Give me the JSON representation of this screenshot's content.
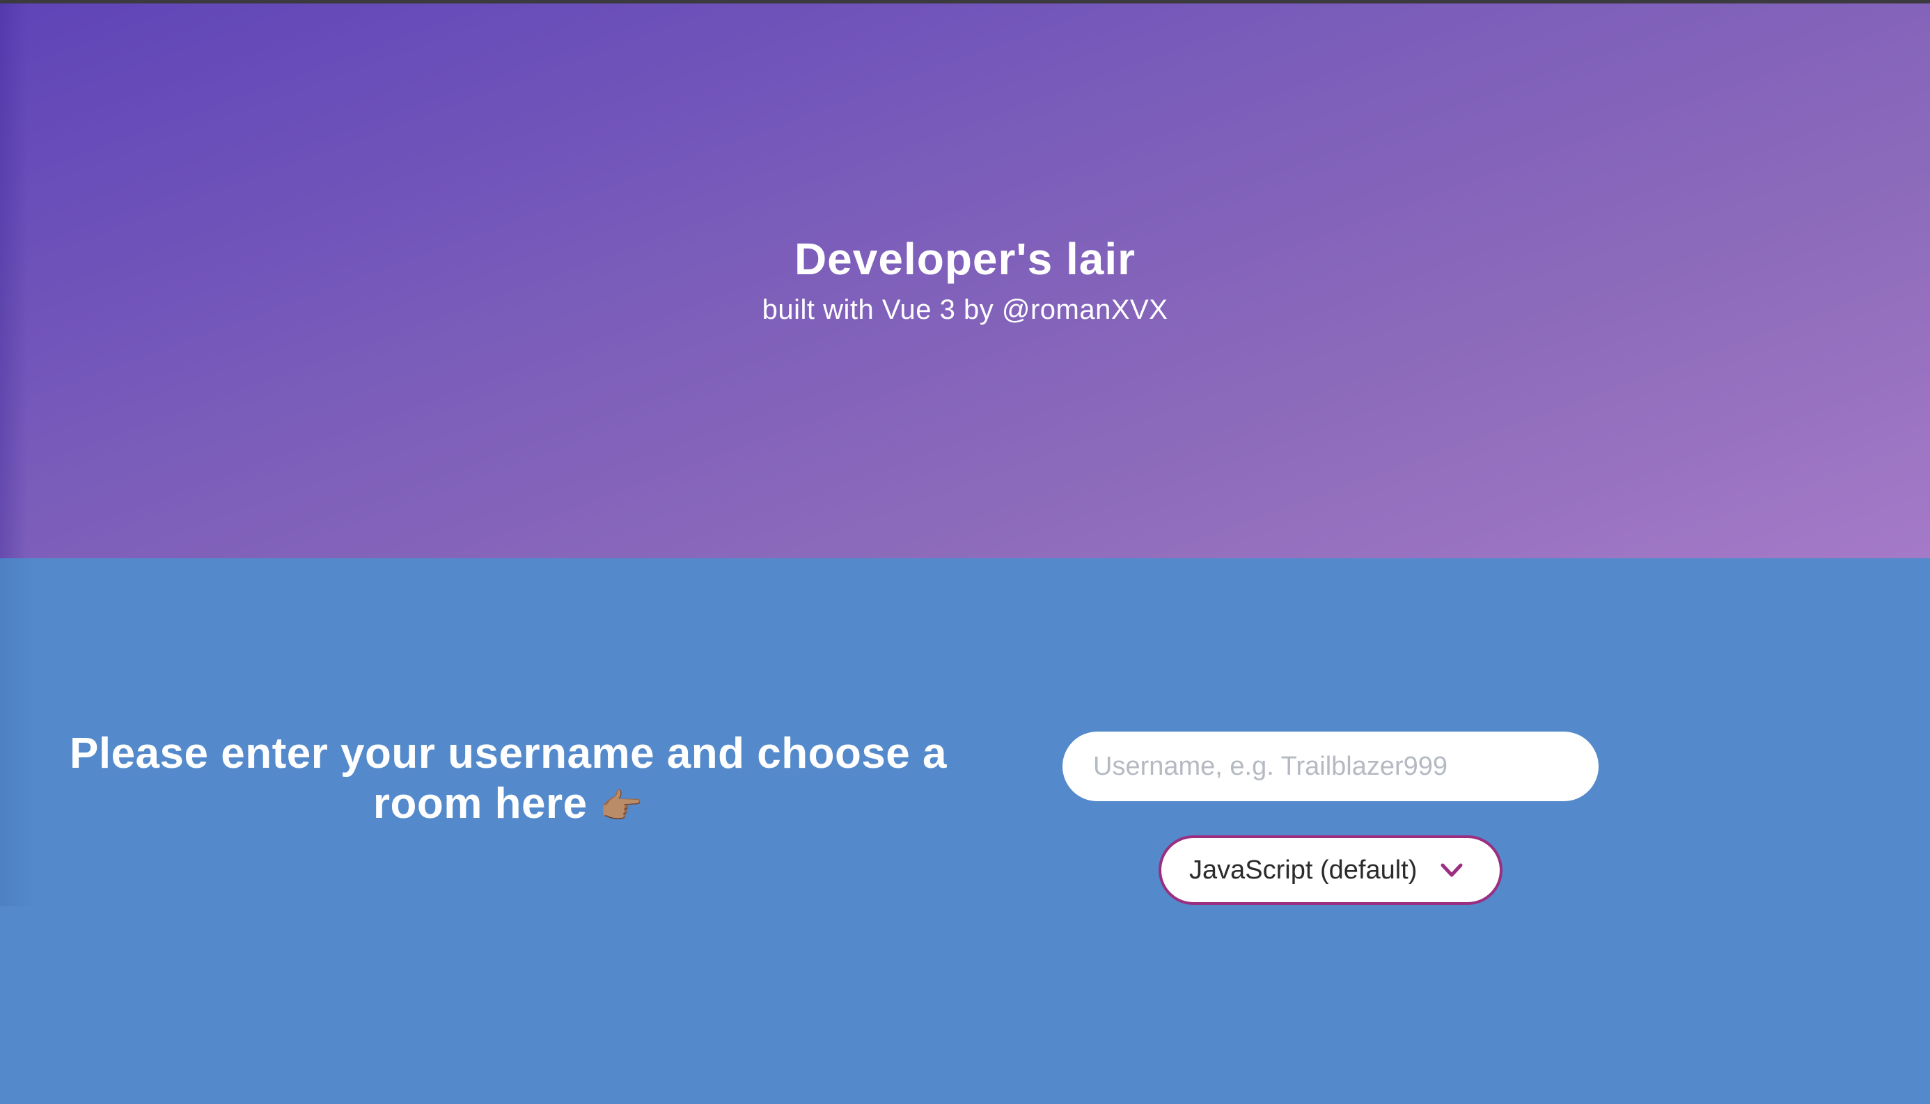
{
  "hero": {
    "title": "Developer's lair",
    "subtitle": "built with Vue 3 by @romanXVX",
    "gradient_start": "#5f44b8",
    "gradient_end": "#a47ac8"
  },
  "main": {
    "background_color": "#548acb",
    "prompt_text": "Please enter your username and choose a room here",
    "prompt_icon": "pointing-right-hand-icon",
    "prompt_emoji": "👉🏽",
    "username_input": {
      "placeholder": "Username, e.g. Trailblazer999",
      "value": ""
    },
    "room_select": {
      "selected": "JavaScript (default)",
      "border_color": "#9a2f82",
      "icon": "chevron-down-icon"
    }
  }
}
